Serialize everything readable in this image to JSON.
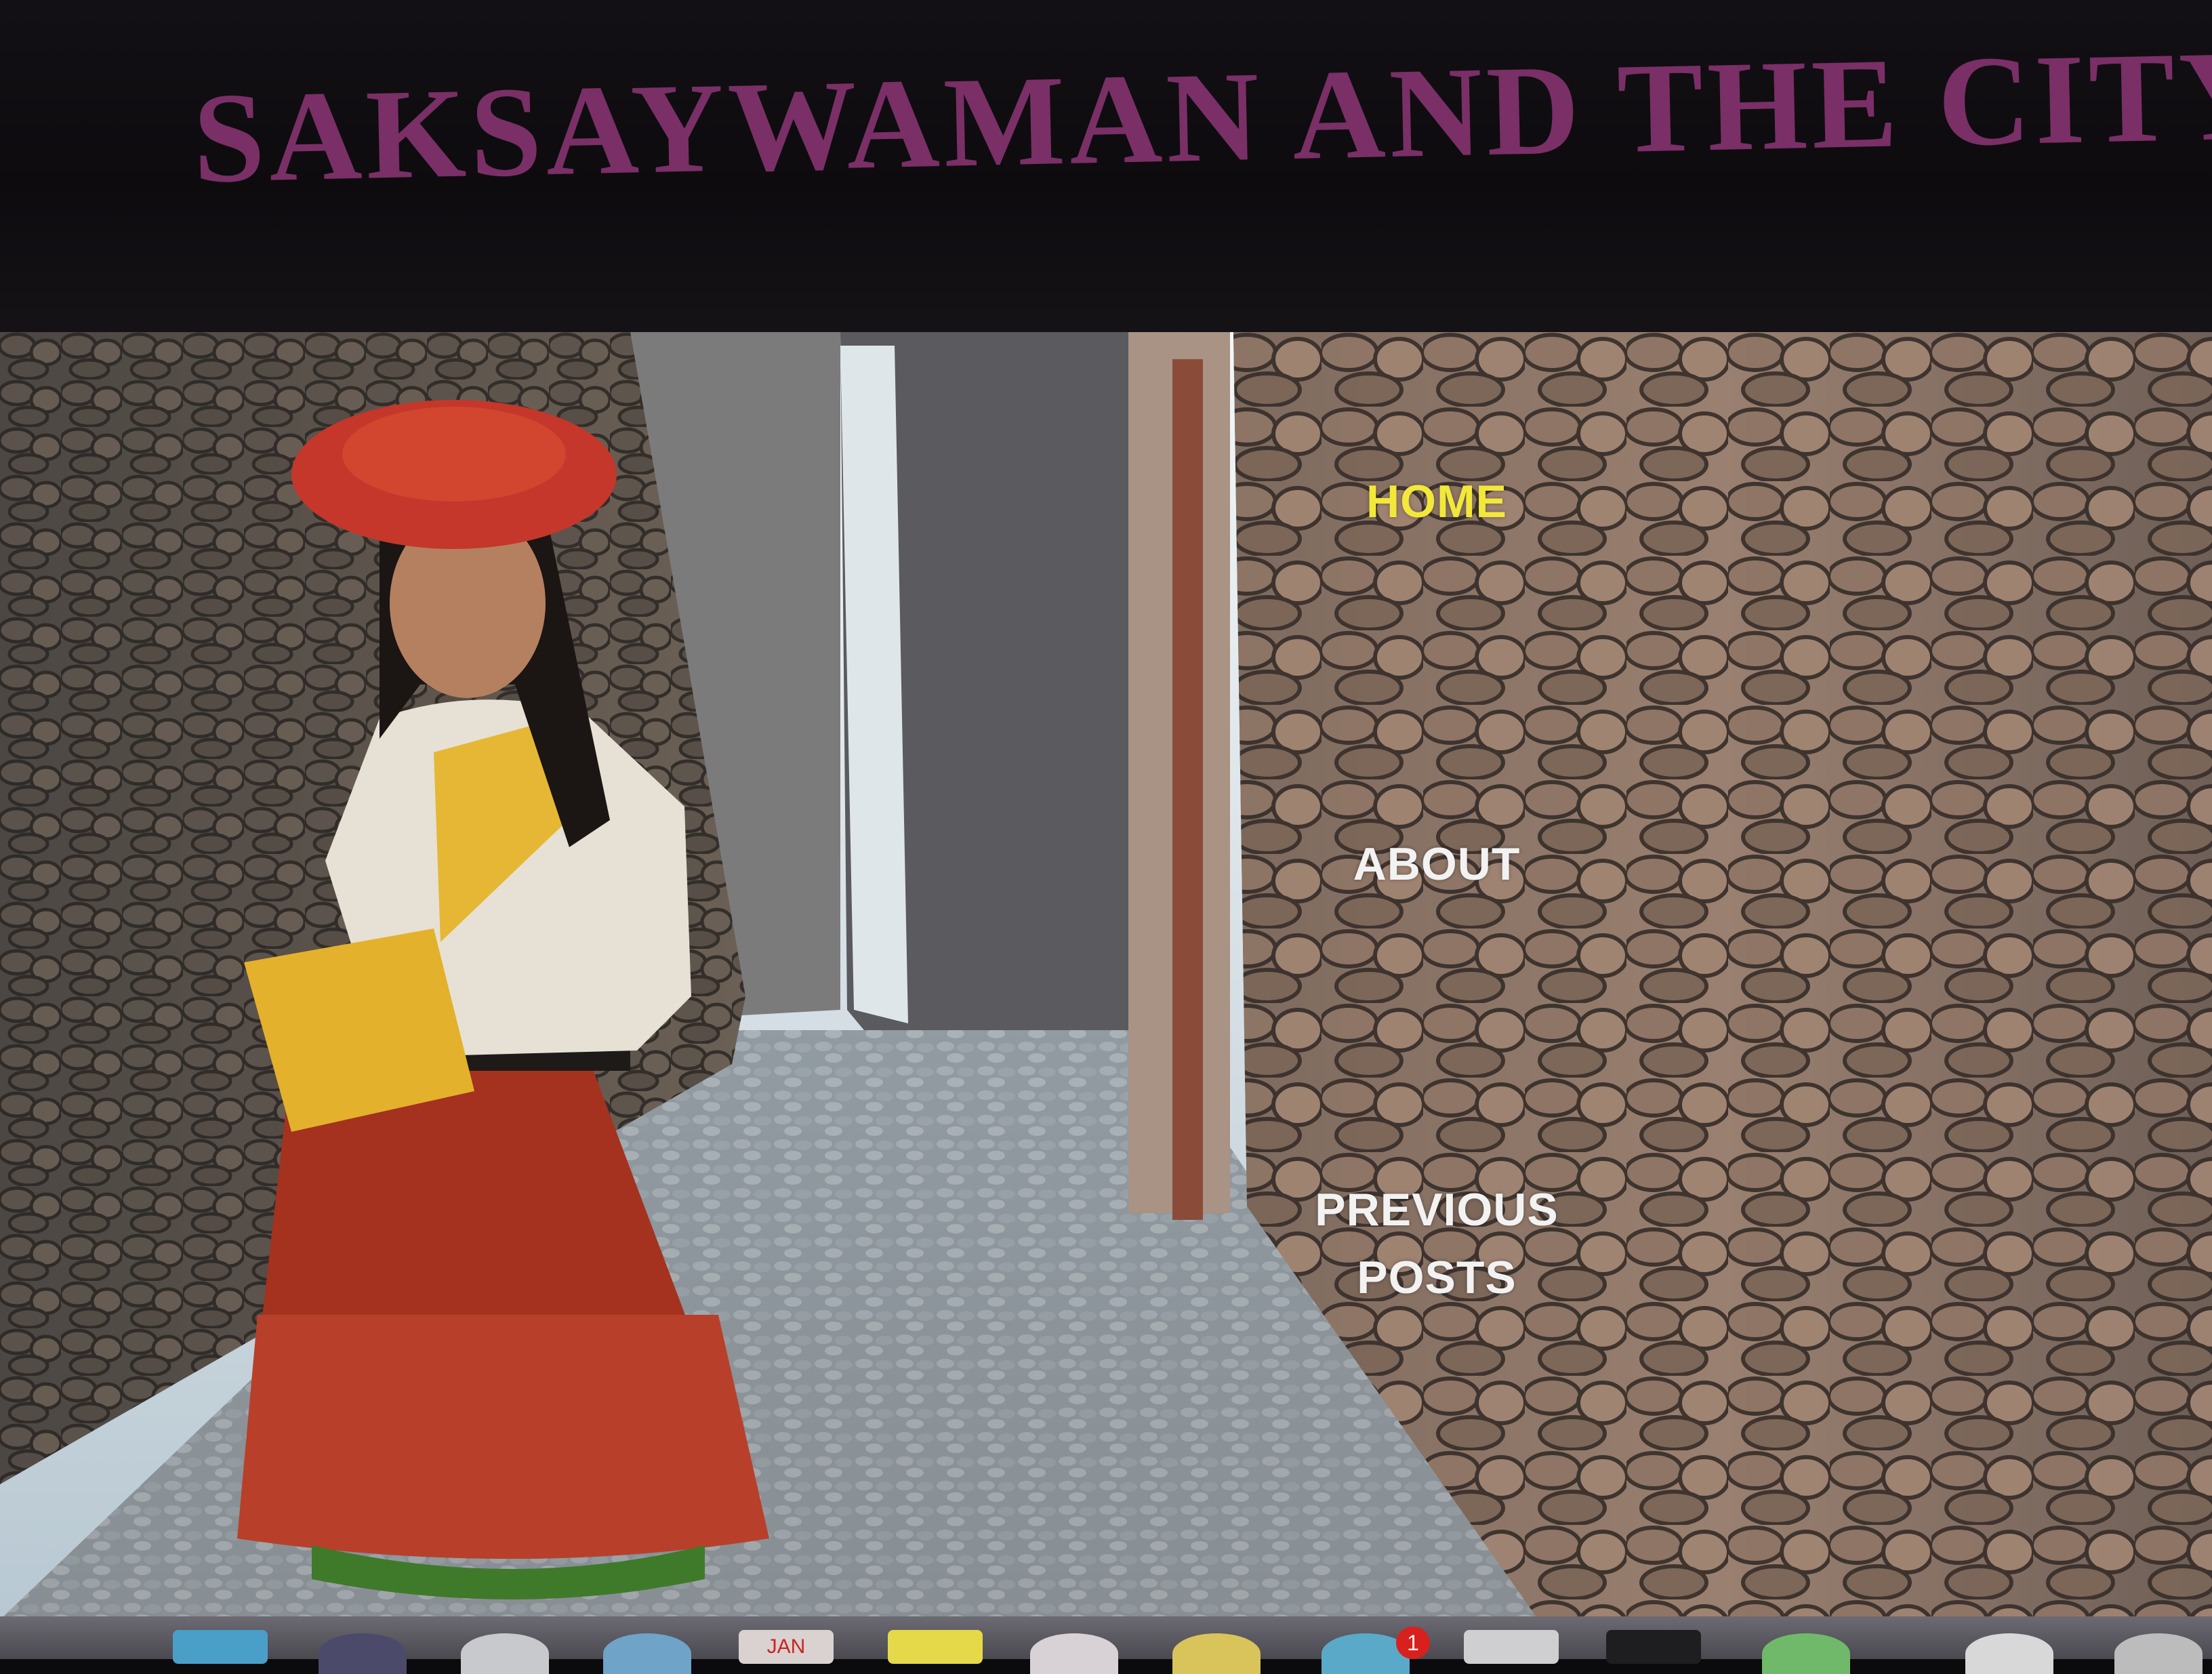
{
  "site": {
    "title": "SAKSAYWAMAN AND THE CITY"
  },
  "nav": {
    "home": "HOME",
    "about": "ABOUT",
    "previous_posts_line1": "PREVIOUS",
    "previous_posts_line2": "POSTS"
  },
  "colors": {
    "title": "#7a2f66",
    "nav_active": "#f2e83a",
    "nav_default": "#f2f2f2",
    "header_bg": "#0d0b0e"
  },
  "hero": {
    "image": "hero-photo",
    "caption": ""
  },
  "dock": {
    "icons": [
      "finder-icon",
      "app-icon",
      "app-icon",
      "browser-icon",
      "calendar-icon",
      "notes-icon",
      "app-icon",
      "app-icon",
      "mail-icon",
      "app-icon",
      "monitor-icon",
      "terminal-icon",
      "app-icon",
      "app-icon",
      "app-icon"
    ],
    "calendar_month": "JAN",
    "mail_badge": "1"
  }
}
